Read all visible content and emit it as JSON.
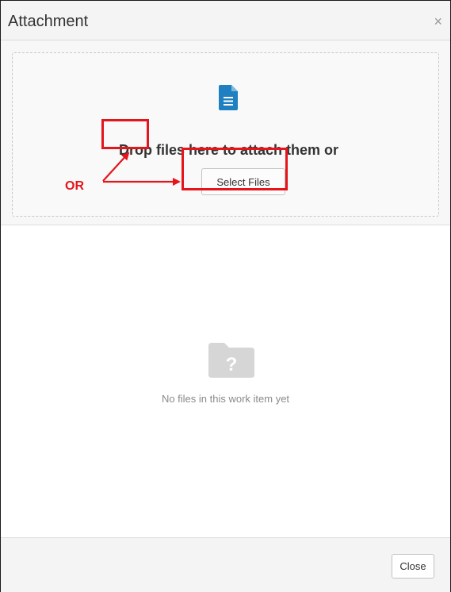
{
  "dialog": {
    "title": "Attachment",
    "close_glyph": "×"
  },
  "dropzone": {
    "icon": "document-icon",
    "drop_text": "Drop files here to attach them or",
    "select_button_label": "Select Files"
  },
  "annotation": {
    "or_label": "OR",
    "color": "#e4151b"
  },
  "empty_state": {
    "icon": "folder-question-icon",
    "message": "No files in this work item yet"
  },
  "footer": {
    "close_button_label": "Close"
  },
  "colors": {
    "doc_icon": "#1e7fc1",
    "folder_icon": "#d6d6d6"
  }
}
